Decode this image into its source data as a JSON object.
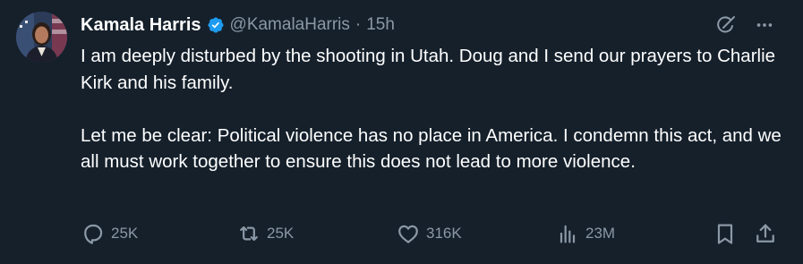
{
  "author": {
    "name": "Kamala Harris",
    "handle": "@KamalaHarris",
    "separator": "·",
    "timestamp": "15h",
    "verified": true
  },
  "tweet": {
    "paragraphs": [
      "I am deeply disturbed by the shooting in Utah. Doug and I send our prayers to Charlie Kirk and his family.",
      "Let me be clear: Political violence has no place in America. I condemn this act, and we all must work together to ensure this does not lead to more violence."
    ]
  },
  "metrics": {
    "replies": "25K",
    "reposts": "25K",
    "likes": "316K",
    "views": "23M"
  },
  "icons": {
    "verified": "verified-badge-icon",
    "grok": "grok-icon",
    "more": "more-icon",
    "reply": "reply-icon",
    "repost": "repost-icon",
    "like": "heart-icon",
    "views": "views-icon",
    "bookmark": "bookmark-icon",
    "share": "share-icon"
  },
  "colors": {
    "background": "#15202b",
    "text": "#ffffff",
    "secondary": "#8b98a5",
    "verified": "#1d9bf0"
  }
}
